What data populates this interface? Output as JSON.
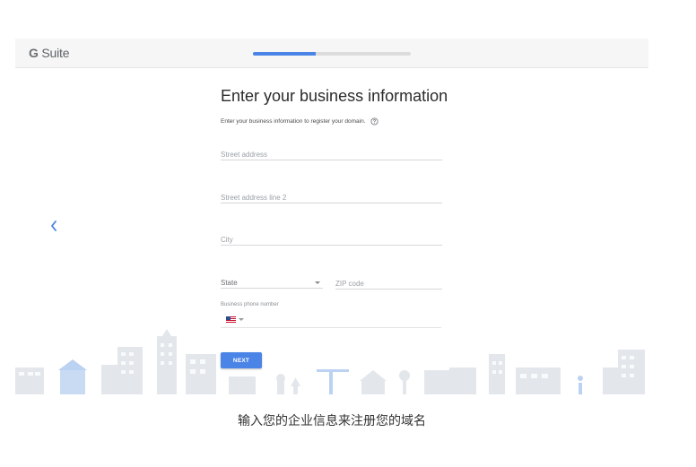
{
  "header": {
    "logo_prefix": "G",
    "logo_suffix": " Suite",
    "progress_fraction": 0.4
  },
  "form": {
    "title": "Enter your business information",
    "subtitle": "Enter your business information to register your domain.",
    "street_placeholder": "Street address",
    "street2_placeholder": "Street address line 2",
    "city_placeholder": "City",
    "state_label": "State",
    "zip_placeholder": "ZIP code",
    "phone_label": "Business phone number",
    "next_label": "NEXT"
  },
  "icons": {
    "back": "chevron-left-icon",
    "help": "help-circle-icon",
    "flag": "us-flag-icon"
  },
  "colors": {
    "accent": "#4a84e6",
    "skyline": "#e3e7ec"
  },
  "caption": "输入您的企业信息来注册您的域名"
}
